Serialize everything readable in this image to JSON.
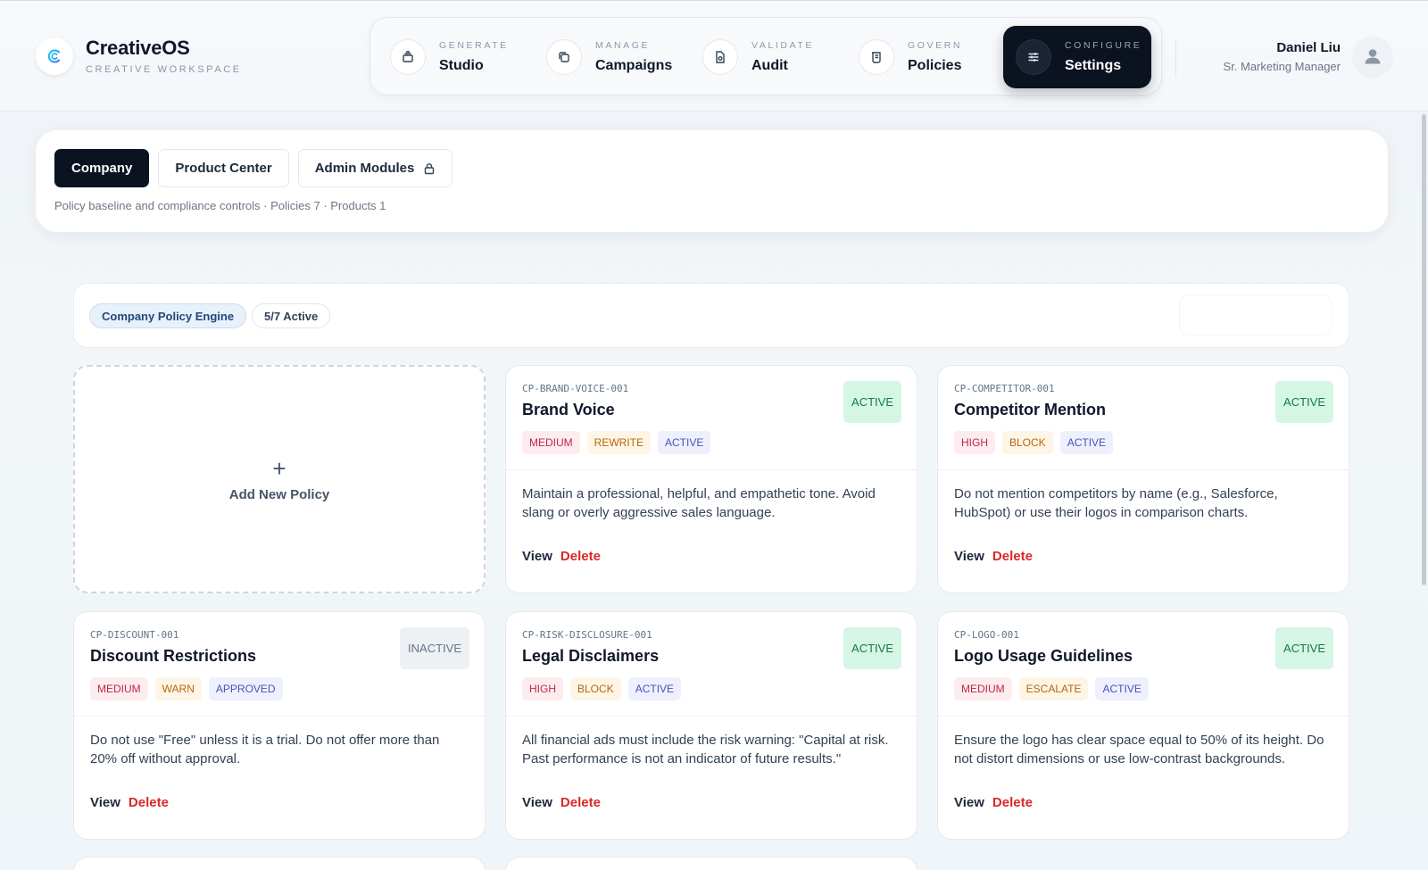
{
  "brand": {
    "name": "CreativeOS",
    "subtitle": "CREATIVE WORKSPACE"
  },
  "nav": {
    "items": [
      {
        "kicker": "GENERATE",
        "label": "Studio",
        "icon": "stack-icon"
      },
      {
        "kicker": "MANAGE",
        "label": "Campaigns",
        "icon": "copy-icon"
      },
      {
        "kicker": "VALIDATE",
        "label": "Audit",
        "icon": "file-check-icon"
      },
      {
        "kicker": "GOVERN",
        "label": "Policies",
        "icon": "scroll-icon"
      },
      {
        "kicker": "CONFIGURE",
        "label": "Settings",
        "icon": "sliders-icon",
        "active": true
      }
    ]
  },
  "user": {
    "name": "Daniel Liu",
    "role": "Sr. Marketing Manager"
  },
  "tabs": [
    {
      "label": "Company",
      "active": true
    },
    {
      "label": "Product Center"
    },
    {
      "label": "Admin Modules",
      "icon": "lock-icon"
    }
  ],
  "panel_meta": "Policy baseline and compliance controls · Policies 7 · Products 1",
  "engine": {
    "title": "Company Policy Engine",
    "active_count": "5/7 Active"
  },
  "add_card": {
    "label": "Add New Policy"
  },
  "actions": {
    "view": "View",
    "delete": "Delete"
  },
  "policies": [
    {
      "id": "CP-BRAND-VOICE-001",
      "title": "Brand Voice",
      "status": "ACTIVE",
      "tags": [
        "MEDIUM",
        "REWRITE",
        "ACTIVE"
      ],
      "description": "Maintain a professional, helpful, and empathetic tone. Avoid slang or overly aggressive sales language."
    },
    {
      "id": "CP-COMPETITOR-001",
      "title": "Competitor Mention",
      "status": "ACTIVE",
      "tags": [
        "HIGH",
        "BLOCK",
        "ACTIVE"
      ],
      "description": "Do not mention competitors by name (e.g., Salesforce, HubSpot) or use their logos in comparison charts."
    },
    {
      "id": "CP-DISCOUNT-001",
      "title": "Discount Restrictions",
      "status": "INACTIVE",
      "tags": [
        "MEDIUM",
        "WARN",
        "APPROVED"
      ],
      "description": "Do not use \"Free\" unless it is a trial. Do not offer more than 20% off without approval."
    },
    {
      "id": "CP-RISK-DISCLOSURE-001",
      "title": "Legal Disclaimers",
      "status": "ACTIVE",
      "tags": [
        "HIGH",
        "BLOCK",
        "ACTIVE"
      ],
      "description": "All financial ads must include the risk warning: \"Capital at risk. Past performance is not an indicator of future results.\""
    },
    {
      "id": "CP-LOGO-001",
      "title": "Logo Usage Guidelines",
      "status": "ACTIVE",
      "tags": [
        "MEDIUM",
        "ESCALATE",
        "ACTIVE"
      ],
      "description": "Ensure the logo has clear space equal to 50% of its height. Do not distort dimensions or use low-contrast backgrounds."
    }
  ],
  "colors": {
    "accent_dark": "#0b1220",
    "status_active_bg": "#d6f6e5",
    "status_active_text": "#0f7a4c",
    "danger": "#dc2626",
    "brand_teal": "#22b8cf"
  }
}
